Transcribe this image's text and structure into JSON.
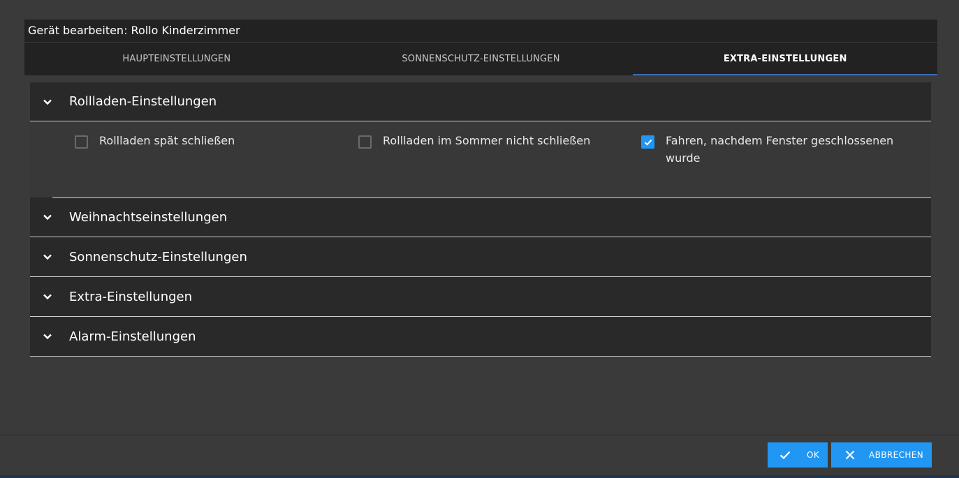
{
  "dialog": {
    "title": "Gerät bearbeiten: Rollo Kinderzimmer"
  },
  "tabs": [
    {
      "label": "HAUPTEINSTELLUNGEN",
      "active": false
    },
    {
      "label": "SONNENSCHUTZ-EINSTELLUNGEN",
      "active": false
    },
    {
      "label": "EXTRA-EINSTELLUNGEN",
      "active": true
    }
  ],
  "panels": [
    {
      "title": "Rollladen-Einstellungen",
      "expanded": true,
      "options": [
        {
          "label": "Rollladen spät schließen",
          "checked": false
        },
        {
          "label": "Rollladen im Sommer nicht schließen",
          "checked": false
        },
        {
          "label": "Fahren, nachdem Fenster geschlossenen wurde",
          "checked": true
        }
      ]
    },
    {
      "title": "Weihnachtseinstellungen",
      "expanded": false
    },
    {
      "title": "Sonnenschutz-Einstellungen",
      "expanded": false
    },
    {
      "title": "Extra-Einstellungen",
      "expanded": false
    },
    {
      "title": "Alarm-Einstellungen",
      "expanded": false
    }
  ],
  "footer": {
    "ok_label": "OK",
    "cancel_label": "ABBRECHEN"
  },
  "colors": {
    "accent": "#2196f3",
    "background": "#3a3a3a",
    "header": "#222222"
  },
  "icons": {
    "expand": "chevron-down-icon",
    "checkbox_checked": "check-icon",
    "ok": "check-icon",
    "cancel": "close-icon"
  }
}
